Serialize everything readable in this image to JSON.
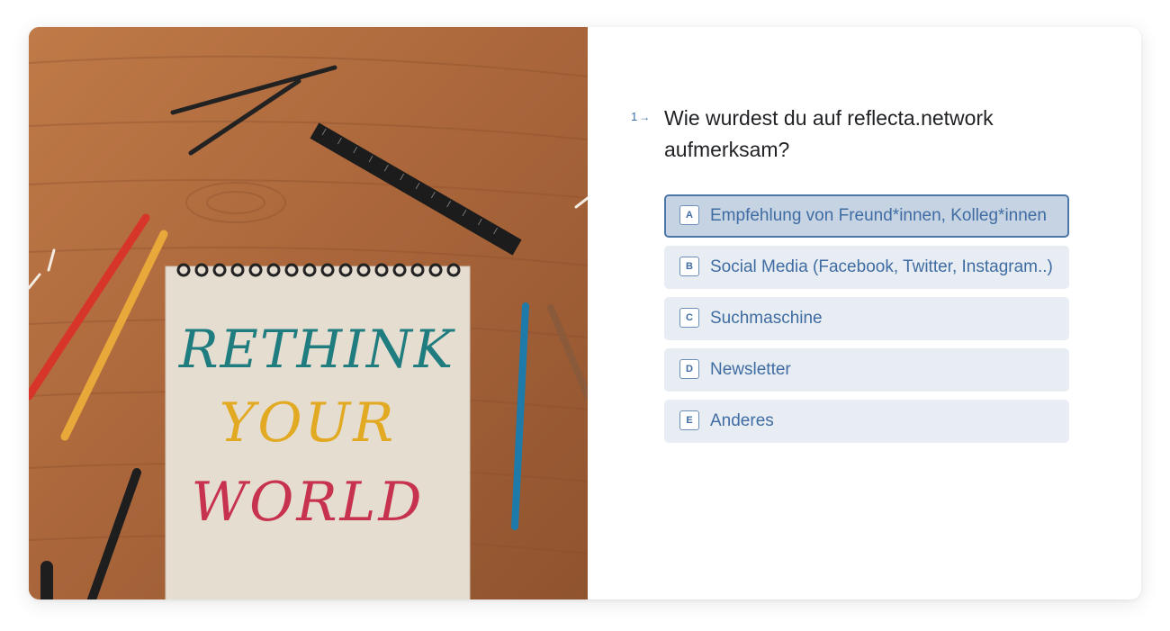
{
  "question": {
    "number": "1",
    "arrow": "→",
    "title": "Wie wurdest du auf reflecta.network aufmerksam?"
  },
  "choices": [
    {
      "key": "A",
      "label": "Empfehlung von Freund*innen, Kolleg*innen",
      "selected": true
    },
    {
      "key": "B",
      "label": "Social Media (Facebook, Twitter, Instagram..)",
      "selected": false
    },
    {
      "key": "C",
      "label": "Suchmaschine",
      "selected": false
    },
    {
      "key": "D",
      "label": "Newsletter",
      "selected": false
    },
    {
      "key": "E",
      "label": "Anderes",
      "selected": false
    }
  ],
  "image": {
    "lettering": [
      "RETHINK",
      "YOUR",
      "WORLD"
    ],
    "colors": {
      "wood": "#b06a3a",
      "paper": "#e6ddd1",
      "rethink": "#1f7c7f",
      "your": "#e2a923",
      "world": "#c7334f"
    }
  },
  "colors": {
    "accent": "#3f6ca2",
    "choice_bg": "#e8edf3",
    "choice_selected_bg": "#c6d3e3",
    "choice_selected_border": "#4d76a8"
  }
}
